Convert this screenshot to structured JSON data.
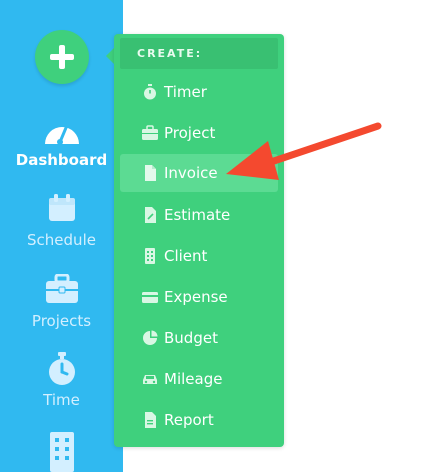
{
  "sidebar": {
    "add_icon": "plus-icon",
    "items": [
      {
        "label": "Dashboard",
        "icon": "gauge-icon",
        "active": true
      },
      {
        "label": "Schedule",
        "icon": "calendar-icon",
        "active": false
      },
      {
        "label": "Projects",
        "icon": "briefcase-icon",
        "active": false
      },
      {
        "label": "Time",
        "icon": "stopwatch-icon",
        "active": false
      },
      {
        "label": "",
        "icon": "building-icon",
        "active": false
      }
    ]
  },
  "create_menu": {
    "header": "CREATE:",
    "items": [
      {
        "label": "Timer",
        "icon": "stopwatch-icon"
      },
      {
        "label": "Project",
        "icon": "briefcase-icon"
      },
      {
        "label": "Invoice",
        "icon": "document-icon",
        "highlighted": true
      },
      {
        "label": "Estimate",
        "icon": "estimate-document-icon"
      },
      {
        "label": "Client",
        "icon": "building-icon"
      },
      {
        "label": "Expense",
        "icon": "credit-card-icon"
      },
      {
        "label": "Budget",
        "icon": "pie-chart-icon"
      },
      {
        "label": "Mileage",
        "icon": "car-icon"
      },
      {
        "label": "Report",
        "icon": "report-document-icon"
      }
    ]
  },
  "colors": {
    "sidebar": "#30b9f0",
    "menu": "#3fd07d",
    "highlight": "#5cdb93",
    "arrow": "#f4492f"
  }
}
